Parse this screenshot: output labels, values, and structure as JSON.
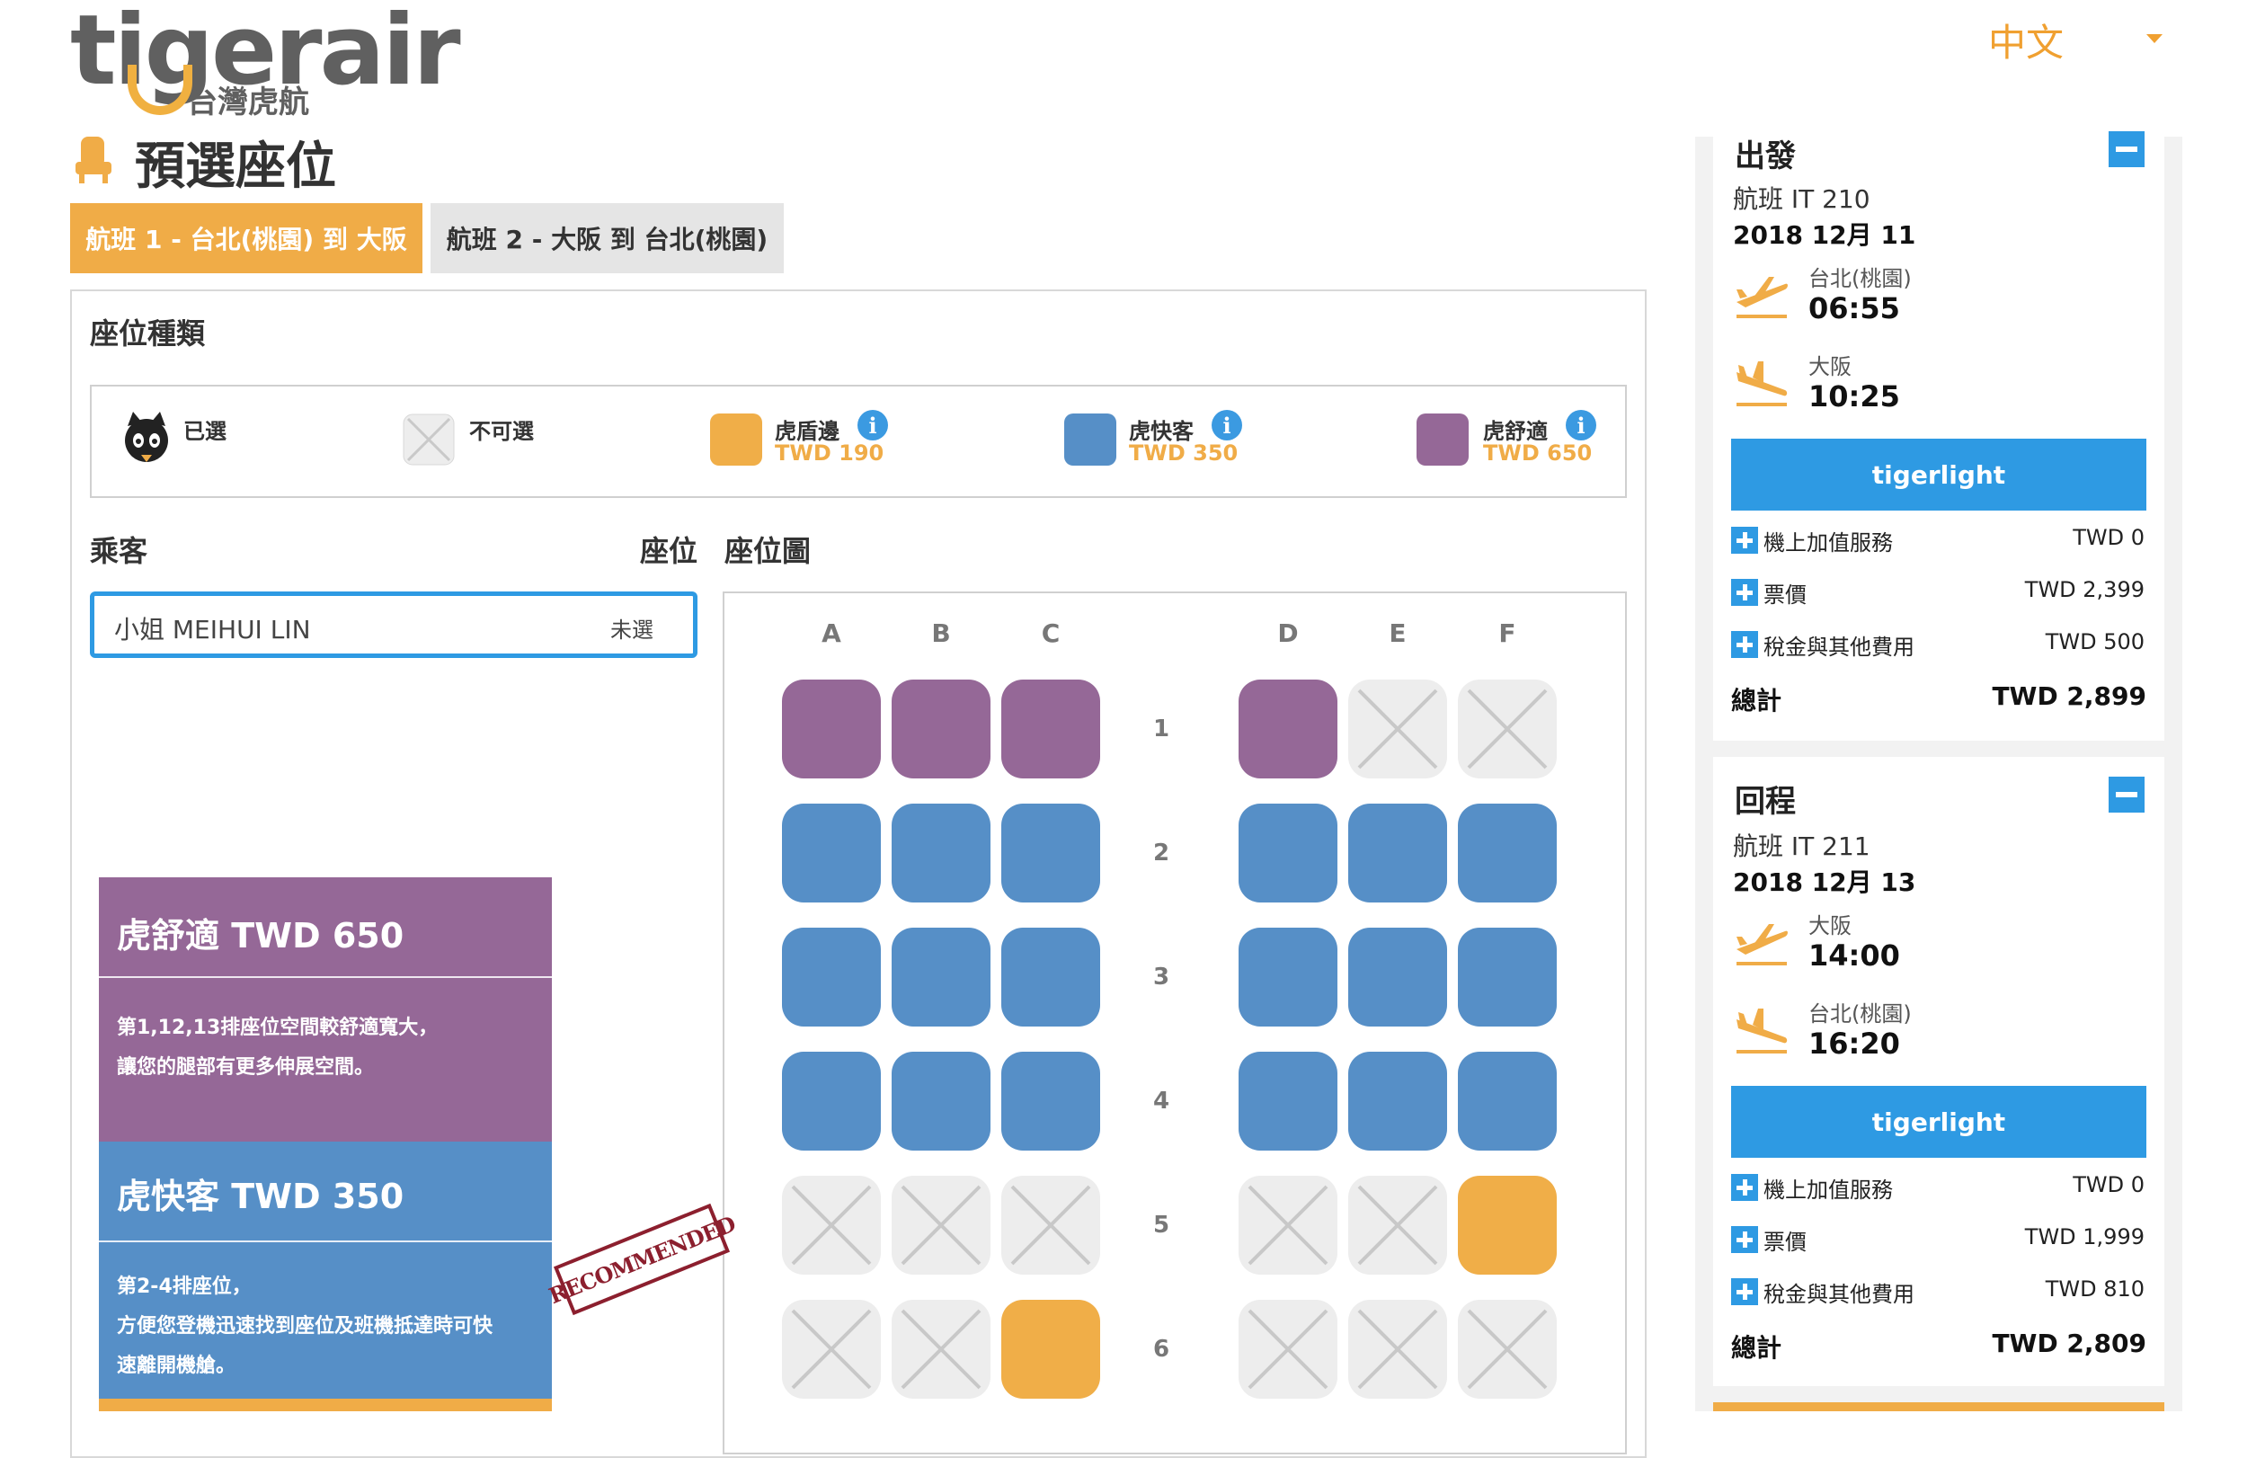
{
  "header": {
    "logo_text": "tigerair",
    "logo_subtitle": "台灣虎航",
    "language": "中文"
  },
  "page": {
    "title": "預選座位"
  },
  "tabs": [
    {
      "label": "航班 1 - 台北(桃園) 到 大阪",
      "active": true
    },
    {
      "label": "航班 2 - 大阪 到 台北(桃園)",
      "active": false
    }
  ],
  "seat_types": {
    "heading": "座位種類",
    "selected_label": "已選",
    "unavailable_label": "不可選",
    "types": [
      {
        "name": "虎盾邊",
        "price": "TWD 190",
        "color": "#f0ae48"
      },
      {
        "name": "虎快客",
        "price": "TWD 350",
        "color": "#568fc7"
      },
      {
        "name": "虎舒適",
        "price": "TWD 650",
        "color": "#956897"
      }
    ]
  },
  "passengers": {
    "heading": "乘客",
    "seat_heading": "座位",
    "seatmap_heading": "座位圖",
    "list": [
      {
        "name": "小姐 MEIHUI LIN",
        "seat": "未選"
      }
    ]
  },
  "seatmap": {
    "columns_left": [
      "A",
      "B",
      "C"
    ],
    "columns_right": [
      "D",
      "E",
      "F"
    ],
    "rows": [
      {
        "number": "1",
        "seats": [
          "purple",
          "purple",
          "purple",
          "purple",
          "na",
          "na"
        ]
      },
      {
        "number": "2",
        "seats": [
          "blue",
          "blue",
          "blue",
          "blue",
          "blue",
          "blue"
        ]
      },
      {
        "number": "3",
        "seats": [
          "blue",
          "blue",
          "blue",
          "blue",
          "blue",
          "blue"
        ]
      },
      {
        "number": "4",
        "seats": [
          "blue",
          "blue",
          "blue",
          "blue",
          "blue",
          "blue"
        ]
      },
      {
        "number": "5",
        "seats": [
          "na",
          "na",
          "na",
          "na",
          "na",
          "orange"
        ]
      },
      {
        "number": "6",
        "seats": [
          "na",
          "na",
          "orange",
          "na",
          "na",
          "na"
        ]
      }
    ]
  },
  "info_cards": [
    {
      "title": "虎舒適 TWD 650",
      "lines": [
        "第1,12,13排座位空間較舒適寬大，",
        "讓您的腿部有更多伸展空間。"
      ]
    },
    {
      "title": "虎快客 TWD 350",
      "lines": [
        "第2-4排座位，",
        "方便您登機迅速找到座位及班機抵達時可快",
        "速離開機艙。"
      ]
    }
  ],
  "stamp": "RECOMMENDED",
  "summary": [
    {
      "title": "出發",
      "flight_no": "航班 IT 210",
      "date": "2018 12月 11",
      "from_city": "台北(桃園)",
      "depart_time": "06:55",
      "to_city": "大阪",
      "arrive_time": "10:25",
      "fare": "tigerlight",
      "fees": [
        {
          "label": "機上加值服務",
          "value": "TWD 0"
        },
        {
          "label": "票價",
          "value": "TWD 2,399"
        },
        {
          "label": "稅金與其他費用",
          "value": "TWD 500"
        }
      ],
      "total_label": "總計",
      "total": "TWD 2,899"
    },
    {
      "title": "回程",
      "flight_no": "航班 IT 211",
      "date": "2018 12月 13",
      "from_city": "大阪",
      "depart_time": "14:00",
      "to_city": "台北(桃園)",
      "arrive_time": "16:20",
      "fare": "tigerlight",
      "fees": [
        {
          "label": "機上加值服務",
          "value": "TWD 0"
        },
        {
          "label": "票價",
          "value": "TWD 1,999"
        },
        {
          "label": "稅金與其他費用",
          "value": "TWD 810"
        }
      ],
      "total_label": "總計",
      "total": "TWD 2,809"
    }
  ]
}
